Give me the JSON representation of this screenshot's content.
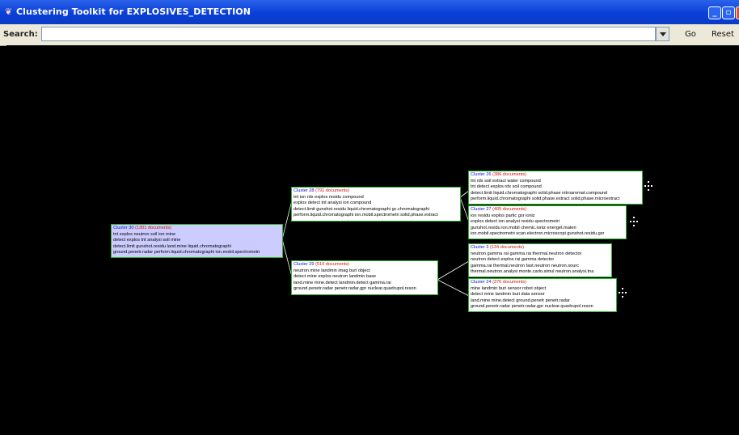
{
  "window": {
    "title": "Clustering Toolkit for EXPLOSIVES_DETECTION",
    "app_icon": "app-icon",
    "controls": [
      "minimize-icon",
      "maximize-icon",
      "close-icon"
    ]
  },
  "search": {
    "label": "Search:",
    "value": "",
    "go_label": "Go",
    "reset_label": "Reset"
  },
  "clusters": [
    {
      "id": "c30",
      "name": "Cluster 30",
      "docs": "(1301 documents)",
      "lines": [
        "tnt  explos  neutron  soil  ion  mine",
        "detect  explos  tnt  analysi  soil  mine",
        "detect.limit  gunshot.residu  land.mine  liquid.chromatographi",
        "ground.penetr.radar   perform.liquid.chromatographi   ion.mobil.spectrometri"
      ]
    },
    {
      "id": "c28",
      "name": "Cluster 28",
      "docs": "(791 documents)",
      "lines": [
        "tnt  ion  rdx  explos  residu  compound",
        "explos  detect  tnt  analysi  ion  compound",
        "detect.limit  gunshot.residu  liquid.chromatographi  gc.chromatographi",
        "perform.liquid.chromatographi   ion.mobil.spectrometri   solid.phase.extract"
      ]
    },
    {
      "id": "c29",
      "name": "Cluster 29",
      "docs": "(510 documents)",
      "lines": [
        "neutron  mine  landmin  imag  buri  object",
        "detect  mine  explos  neutron  landmin  base",
        "land.mine  mine.detect  landmin.detect  gamma.rai",
        "ground.penetr.radar   penetr.radar.gpr   nuclear.quadrupol.reson"
      ]
    },
    {
      "id": "c26",
      "name": "Cluster 26",
      "docs": "(386 documents)",
      "lines": [
        "tnt  rdx  soil  extract  water  compound",
        "tnt  detect  explos  rdx  soil  compound",
        "detect.limit  liquid.chromatographi  solid.phase  nitroaromat.compound",
        "perform.liquid.chromatographi   solid.phase.extract   solid.phase.microextract"
      ]
    },
    {
      "id": "c27",
      "name": "Cluster 27",
      "docs": "(405 documents)",
      "lines": [
        "ion  residu  explos  partic  gsr  ioniz",
        "explos  detect  ion  analysi  residu  spectrometri",
        "gunshot.residu  ion.mobil  chemic.ioniz  energet.materi",
        "ion.mobil.spectrometri   scan.electron.microscopi   gunshot.residu.gsr"
      ]
    },
    {
      "id": "c3",
      "name": "Cluster 3",
      "docs": "(134 documents)",
      "lines": [
        "neutron  gamma  rai  gamma.rai  thermal.neutron  detector",
        "neutron  detect  explos  rai  gamma  detector",
        "gamma.rai  thermal.neutron  fast.neutron  neutron.sourc",
        "thermal.neutron.analysi   monte.carlo.simul   neutron.analysi.tna"
      ]
    },
    {
      "id": "c24",
      "name": "Cluster 24",
      "docs": "(376 documents)",
      "lines": [
        "mine  landmin  buri  sensor  robot  object",
        "detect  mine  landmin  buri  data  sensor",
        "land.mine  mine.detect  ground.penetr  penetr.radar",
        "ground.penetr.radar   penetr.radar.gpr   nuclear.quadrupol.reson"
      ]
    }
  ],
  "tree_icons": [
    "tree-expand-icon",
    "tree-expand-icon",
    "tree-expand-icon"
  ]
}
